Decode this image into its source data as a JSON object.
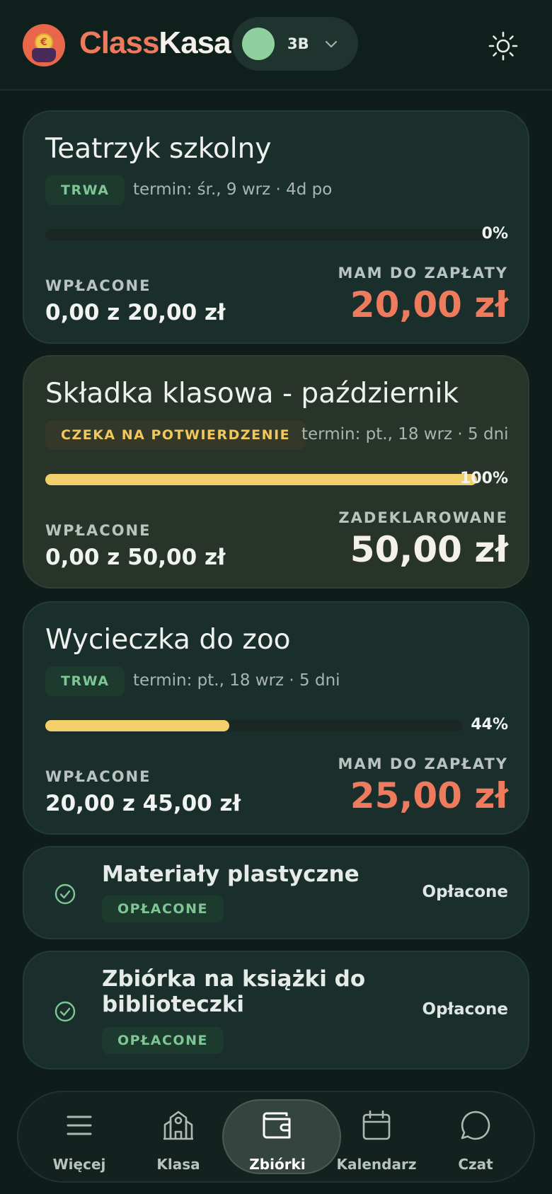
{
  "header": {
    "brand_part1": "Class",
    "brand_part2": "Kasa",
    "logo_coin": "€",
    "class_selector": {
      "label": "3B"
    },
    "theme_icon": "sun-icon"
  },
  "collections": [
    {
      "title": "Teatrzyk szkolny",
      "status": "TRWA",
      "deadline": "termin: śr., 9 wrz · 4d po",
      "progress": 0,
      "progress_label": "0%",
      "paid_label": "WPŁACONE",
      "paid_value": "0,00 z 20,00 zł",
      "right_label": "MAM DO ZAPŁATY",
      "right_amount": "20,00 zł"
    },
    {
      "title": "Składka klasowa - październik",
      "status": "CZEKA NA POTWIERDZENIE",
      "deadline": "termin: pt., 18 wrz · 5 dni",
      "progress": 100,
      "progress_label": "100%",
      "paid_label": "WPŁACONE",
      "paid_value": "0,00 z 50,00 zł",
      "right_label": "ZADEKLAROWANE",
      "right_amount": "50,00 zł"
    },
    {
      "title": "Wycieczka do zoo",
      "status": "TRWA",
      "deadline": "termin: pt., 18 wrz · 5 dni",
      "progress": 44,
      "progress_label": "44%",
      "paid_label": "WPŁACONE",
      "paid_value": "20,00 z 45,00 zł",
      "right_label": "MAM DO ZAPŁATY",
      "right_amount": "25,00 zł"
    }
  ],
  "paid_collections": [
    {
      "title": "Materiały plastyczne",
      "badge": "OPŁACONE",
      "status": "Opłacone"
    },
    {
      "title_line1": "Zbiórka na książki do",
      "title_line2": "biblioteczki",
      "badge": "OPŁACONE",
      "status": "Opłacone"
    }
  ],
  "bottom_nav": [
    {
      "label": "Więcej",
      "icon": "menu-icon"
    },
    {
      "label": "Klasa",
      "icon": "school-icon"
    },
    {
      "label": "Zbiórki",
      "icon": "wallet-icon",
      "active": true
    },
    {
      "label": "Kalendarz",
      "icon": "calendar-icon"
    },
    {
      "label": "Czat",
      "icon": "chat-icon"
    }
  ],
  "colors": {
    "accent": "#ee7a5d",
    "due_amount": "#ef7b5f",
    "progress": "#f2cf6a",
    "status_green": "#7ec794",
    "status_yellow": "#f0c95a"
  }
}
